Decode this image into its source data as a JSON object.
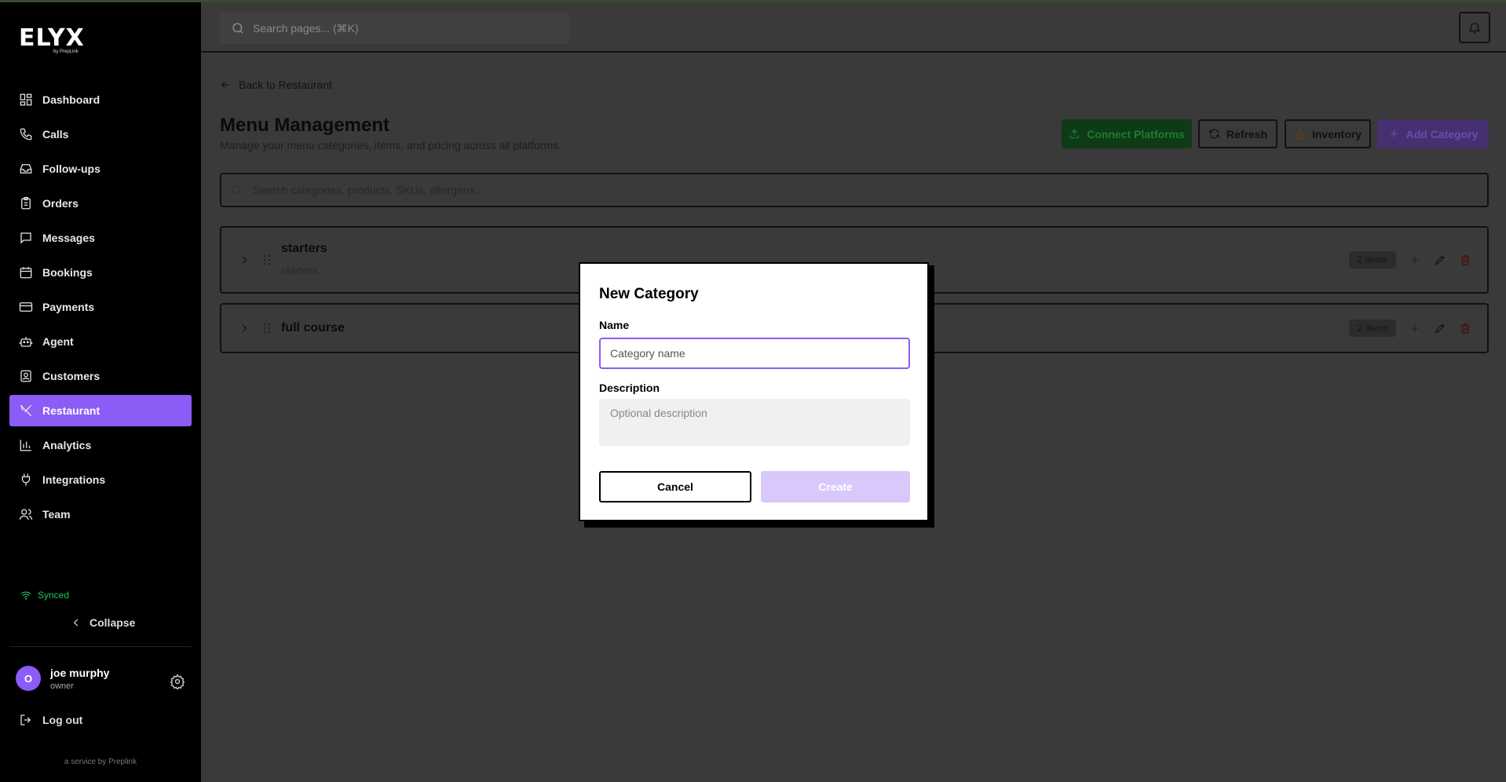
{
  "brand": {
    "logo": "ELYX",
    "tagline": "by PrepLink"
  },
  "sidebar": {
    "items": [
      {
        "label": "Dashboard",
        "icon": "grid-icon",
        "active": false
      },
      {
        "label": "Calls",
        "icon": "phone-icon",
        "active": false
      },
      {
        "label": "Follow-ups",
        "icon": "inbox-icon",
        "active": false
      },
      {
        "label": "Orders",
        "icon": "clipboard-icon",
        "active": false
      },
      {
        "label": "Messages",
        "icon": "message-icon",
        "active": false
      },
      {
        "label": "Bookings",
        "icon": "calendar-icon",
        "active": false
      },
      {
        "label": "Payments",
        "icon": "card-icon",
        "active": false
      },
      {
        "label": "Agent",
        "icon": "robot-icon",
        "active": false
      },
      {
        "label": "Customers",
        "icon": "contact-icon",
        "active": false
      },
      {
        "label": "Restaurant",
        "icon": "utensils-icon",
        "active": true
      },
      {
        "label": "Analytics",
        "icon": "bar-chart-icon",
        "active": false
      },
      {
        "label": "Integrations",
        "icon": "plug-icon",
        "active": false
      },
      {
        "label": "Team",
        "icon": "users-icon",
        "active": false
      }
    ],
    "status": "Synced",
    "collapse_label": "Collapse",
    "user": {
      "initial": "O",
      "name": "joe murphy",
      "role": "owner"
    },
    "logout_label": "Log out",
    "footer": "a service by Preplink"
  },
  "header": {
    "search_placeholder": "Search pages... (⌘K)"
  },
  "main": {
    "back_label": "Back to Restaurant",
    "title": "Menu Management",
    "subtitle": "Manage your menu categories, items, and pricing across all platforms.",
    "buttons": {
      "connect": "Connect Platforms",
      "refresh": "Refresh",
      "inventory": "Inventory",
      "add": "Add Category"
    },
    "search_placeholder": "Search categories, products, SKUs, allergens...",
    "categories": [
      {
        "name": "starters",
        "description": "starters",
        "count": "2 items"
      },
      {
        "name": "full course",
        "description": "",
        "count": "2 items"
      }
    ]
  },
  "modal": {
    "title": "New Category",
    "name_label": "Name",
    "name_placeholder": "Category name",
    "name_value": "",
    "description_label": "Description",
    "description_placeholder": "Optional description",
    "cancel_label": "Cancel",
    "create_label": "Create"
  },
  "colors": {
    "accent": "#8b5cf6",
    "success": "#22c55e",
    "create_disabled": "#d8c8fb",
    "overlay": "#3a3a3a"
  }
}
